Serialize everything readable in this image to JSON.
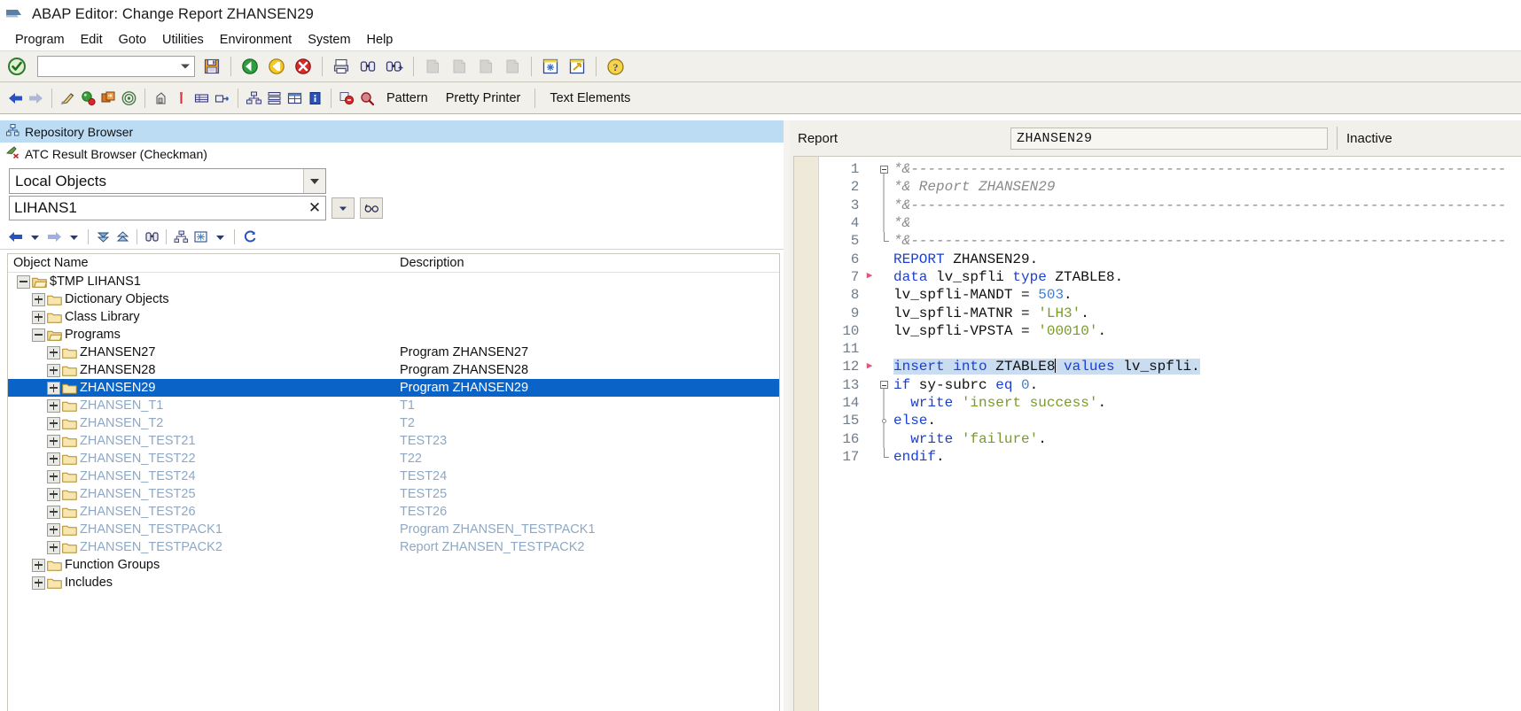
{
  "window": {
    "title": "ABAP Editor: Change Report ZHANSEN29",
    "logo_icon": "sap-ribbon-icon"
  },
  "menubar": {
    "items": [
      {
        "label": "Program"
      },
      {
        "label": "Edit"
      },
      {
        "label": "Goto"
      },
      {
        "label": "Utilities"
      },
      {
        "label": "Environment"
      },
      {
        "label": "System"
      },
      {
        "label": "Help"
      }
    ]
  },
  "toolbar_primary": {
    "enter_icon": "green-check-circle-icon",
    "command_field": {
      "value": "",
      "placeholder": ""
    },
    "command_dropdown_icon": "chevron-down-icon",
    "buttons": [
      {
        "name": "save-button",
        "icon": "save-disk-icon",
        "enabled": true
      },
      {
        "name": "back-button",
        "icon": "green-back-arrow-icon",
        "enabled": true
      },
      {
        "name": "exit-button",
        "icon": "yellow-exit-arrow-icon",
        "enabled": true
      },
      {
        "name": "cancel-button",
        "icon": "red-cancel-x-icon",
        "enabled": true
      },
      {
        "name": "print-button",
        "icon": "printer-icon",
        "enabled": true
      },
      {
        "name": "find-button",
        "icon": "binoculars-icon",
        "enabled": true
      },
      {
        "name": "find-next-button",
        "icon": "binoculars-plus-icon",
        "enabled": true
      },
      {
        "name": "first-page-button",
        "icon": "first-page-icon",
        "enabled": false
      },
      {
        "name": "previous-page-button",
        "icon": "previous-page-icon",
        "enabled": false
      },
      {
        "name": "next-page-button",
        "icon": "next-page-icon",
        "enabled": false
      },
      {
        "name": "last-page-button",
        "icon": "last-page-icon",
        "enabled": false
      },
      {
        "name": "create-session-button",
        "icon": "new-session-icon",
        "enabled": true
      },
      {
        "name": "create-shortcut-button",
        "icon": "shortcut-arrow-icon",
        "enabled": true
      },
      {
        "name": "help-button",
        "icon": "yellow-question-help-icon",
        "enabled": true
      }
    ]
  },
  "toolbar_secondary": {
    "buttons": [
      {
        "name": "back-nav-button",
        "icon": "blue-left-arrow-icon",
        "enabled": true
      },
      {
        "name": "forward-nav-button",
        "icon": "blue-right-arrow-icon",
        "enabled": false
      },
      {
        "name": "check-syntax-button",
        "icon": "syntax-check-pen-icon",
        "enabled": true
      },
      {
        "name": "activate-button",
        "icon": "activate-match-icon",
        "enabled": true
      },
      {
        "name": "display-change-button",
        "icon": "display-change-icon",
        "enabled": true
      },
      {
        "name": "where-used-button",
        "icon": "where-used-target-icon",
        "enabled": true
      },
      {
        "name": "debug-button",
        "icon": "debug-icon",
        "enabled": true
      },
      {
        "name": "breakpoint-button",
        "icon": "breakpoint-marker-icon",
        "enabled": true
      },
      {
        "name": "display-object-list-button",
        "icon": "object-list-icon",
        "enabled": true
      },
      {
        "name": "other-object-button",
        "icon": "other-object-icon",
        "enabled": true
      },
      {
        "name": "object-navigator-button",
        "icon": "navigator-tree-icon",
        "enabled": true
      },
      {
        "name": "stacked-list-button",
        "icon": "stacked-list-icon",
        "enabled": true
      },
      {
        "name": "table-display-button",
        "icon": "table-grid-icon",
        "enabled": true
      },
      {
        "name": "info-button",
        "icon": "blue-info-icon",
        "enabled": true
      },
      {
        "name": "replace-button",
        "icon": "replace-icon",
        "enabled": true
      },
      {
        "name": "search-object-button",
        "icon": "search-magnifier-icon",
        "enabled": true
      }
    ],
    "labels": [
      {
        "name": "pattern-button",
        "label": "Pattern"
      },
      {
        "name": "pretty-printer-button",
        "label": "Pretty Printer"
      },
      {
        "name": "text-elements-button",
        "label": "Text Elements"
      }
    ]
  },
  "left_panel": {
    "tabs": [
      {
        "label": "Repository Browser",
        "icon": "repository-tree-icon",
        "active": true
      },
      {
        "label": "ATC Result Browser (Checkman)",
        "icon": "atc-check-icon",
        "active": false
      }
    ],
    "object_type_select": {
      "value": "Local Objects",
      "options": [
        "Local Objects"
      ]
    },
    "search_field": {
      "value": "LIHANS1",
      "placeholder": "",
      "clear_icon": "close-x-icon",
      "dropdown_icon": "chevron-down-icon",
      "display_icon": "display-glasses-icon"
    },
    "tree_toolbar": [
      {
        "name": "tree-back-button",
        "icon": "left-arrow-icon"
      },
      {
        "name": "tree-back-history-button",
        "icon": "chevron-down-icon"
      },
      {
        "name": "tree-forward-button",
        "icon": "right-arrow-icon"
      },
      {
        "name": "tree-forward-history-button",
        "icon": "chevron-down-icon"
      },
      {
        "name": "expand-all-button",
        "icon": "expand-down-stack-icon"
      },
      {
        "name": "collapse-all-button",
        "icon": "collapse-up-stack-icon"
      },
      {
        "name": "find-in-tree-button",
        "icon": "binoculars-icon"
      },
      {
        "name": "tree-hierarchy-button",
        "icon": "hierarchy-icon"
      },
      {
        "name": "tree-layout-button",
        "icon": "layout-grid-icon"
      },
      {
        "name": "tree-layout-menu-button",
        "icon": "chevron-down-icon"
      },
      {
        "name": "refresh-tree-button",
        "icon": "refresh-icon"
      }
    ],
    "columns": [
      {
        "label": "Object Name"
      },
      {
        "label": "Description"
      }
    ],
    "tree": [
      {
        "name": "$TMP LIHANS1",
        "description": "",
        "depth": 0,
        "toggle": "minus",
        "folder": "open",
        "state": "normal"
      },
      {
        "name": "Dictionary Objects",
        "description": "",
        "depth": 1,
        "toggle": "plus",
        "folder": "closed",
        "state": "normal"
      },
      {
        "name": "Class Library",
        "description": "",
        "depth": 1,
        "toggle": "plus",
        "folder": "closed",
        "state": "normal"
      },
      {
        "name": "Programs",
        "description": "",
        "depth": 1,
        "toggle": "minus",
        "folder": "open",
        "state": "normal"
      },
      {
        "name": "ZHANSEN27",
        "description": "Program ZHANSEN27",
        "depth": 2,
        "toggle": "plus",
        "folder": "closed",
        "state": "normal"
      },
      {
        "name": "ZHANSEN28",
        "description": "Program ZHANSEN28",
        "depth": 2,
        "toggle": "plus",
        "folder": "closed",
        "state": "normal"
      },
      {
        "name": "ZHANSEN29",
        "description": "Program ZHANSEN29",
        "depth": 2,
        "toggle": "plus",
        "folder": "closed",
        "state": "selected"
      },
      {
        "name": "ZHANSEN_T1",
        "description": "T1",
        "depth": 2,
        "toggle": "plus",
        "folder": "closed",
        "state": "dim"
      },
      {
        "name": "ZHANSEN_T2",
        "description": "T2",
        "depth": 2,
        "toggle": "plus",
        "folder": "closed",
        "state": "dim"
      },
      {
        "name": "ZHANSEN_TEST21",
        "description": "TEST23",
        "depth": 2,
        "toggle": "plus",
        "folder": "closed",
        "state": "dim"
      },
      {
        "name": "ZHANSEN_TEST22",
        "description": "T22",
        "depth": 2,
        "toggle": "plus",
        "folder": "closed",
        "state": "dim"
      },
      {
        "name": "ZHANSEN_TEST24",
        "description": "TEST24",
        "depth": 2,
        "toggle": "plus",
        "folder": "closed",
        "state": "dim"
      },
      {
        "name": "ZHANSEN_TEST25",
        "description": "TEST25",
        "depth": 2,
        "toggle": "plus",
        "folder": "closed",
        "state": "dim"
      },
      {
        "name": "ZHANSEN_TEST26",
        "description": "TEST26",
        "depth": 2,
        "toggle": "plus",
        "folder": "closed",
        "state": "dim"
      },
      {
        "name": "ZHANSEN_TESTPACK1",
        "description": "Program ZHANSEN_TESTPACK1",
        "depth": 2,
        "toggle": "plus",
        "folder": "closed",
        "state": "dim"
      },
      {
        "name": "ZHANSEN_TESTPACK2",
        "description": "Report ZHANSEN_TESTPACK2",
        "depth": 2,
        "toggle": "plus",
        "folder": "closed",
        "state": "dim"
      },
      {
        "name": "Function Groups",
        "description": "",
        "depth": 1,
        "toggle": "plus",
        "folder": "closed",
        "state": "normal"
      },
      {
        "name": "Includes",
        "description": "",
        "depth": 1,
        "toggle": "plus",
        "folder": "closed",
        "state": "normal"
      }
    ]
  },
  "right_panel": {
    "report_label": "Report",
    "report_name": "ZHANSEN29",
    "status": "Inactive",
    "code": [
      {
        "num": "1",
        "breakpoint": false,
        "fold": "start",
        "tokens": [
          {
            "t": "*&----------------------------------------------------------------------",
            "c": "cmt"
          }
        ]
      },
      {
        "num": "2",
        "breakpoint": false,
        "fold": "line",
        "tokens": [
          {
            "t": "*& Report ZHANSEN29",
            "c": "cmt"
          }
        ]
      },
      {
        "num": "3",
        "breakpoint": false,
        "fold": "line",
        "tokens": [
          {
            "t": "*&----------------------------------------------------------------------",
            "c": "cmt"
          }
        ]
      },
      {
        "num": "4",
        "breakpoint": false,
        "fold": "line",
        "tokens": [
          {
            "t": "*&",
            "c": "cmt"
          }
        ]
      },
      {
        "num": "5",
        "breakpoint": false,
        "fold": "end",
        "tokens": [
          {
            "t": "*&----------------------------------------------------------------------",
            "c": "cmt"
          }
        ]
      },
      {
        "num": "6",
        "breakpoint": false,
        "fold": "none",
        "tokens": [
          {
            "t": "REPORT",
            "c": "kw"
          },
          {
            "t": " ZHANSEN29.",
            "c": "plain"
          }
        ]
      },
      {
        "num": "7",
        "breakpoint": true,
        "fold": "none",
        "tokens": [
          {
            "t": "data",
            "c": "kw"
          },
          {
            "t": " lv_spfli ",
            "c": "plain"
          },
          {
            "t": "type",
            "c": "kw"
          },
          {
            "t": " ZTABLE8.",
            "c": "plain"
          }
        ]
      },
      {
        "num": "8",
        "breakpoint": false,
        "fold": "none",
        "tokens": [
          {
            "t": "lv_spfli-MANDT = ",
            "c": "plain"
          },
          {
            "t": "503",
            "c": "num"
          },
          {
            "t": ".",
            "c": "plain"
          }
        ]
      },
      {
        "num": "9",
        "breakpoint": false,
        "fold": "none",
        "tokens": [
          {
            "t": "lv_spfli-MATNR = ",
            "c": "plain"
          },
          {
            "t": "'LH3'",
            "c": "str"
          },
          {
            "t": ".",
            "c": "plain"
          }
        ]
      },
      {
        "num": "10",
        "breakpoint": false,
        "fold": "none",
        "tokens": [
          {
            "t": "lv_spfli-VPSTA = ",
            "c": "plain"
          },
          {
            "t": "'00010'",
            "c": "str"
          },
          {
            "t": ".",
            "c": "plain"
          }
        ]
      },
      {
        "num": "11",
        "breakpoint": false,
        "fold": "none",
        "tokens": []
      },
      {
        "num": "12",
        "breakpoint": true,
        "fold": "none",
        "selected": true,
        "tokens": [
          {
            "t": "insert into",
            "c": "kw"
          },
          {
            "t": " ZTABLE8",
            "c": "plain"
          },
          {
            "t": "|CARET|",
            "c": "caret"
          },
          {
            "t": " ",
            "c": "plain"
          },
          {
            "t": "values",
            "c": "kw"
          },
          {
            "t": " lv_spfli.",
            "c": "plain"
          }
        ]
      },
      {
        "num": "13",
        "breakpoint": false,
        "fold": "start",
        "tokens": [
          {
            "t": "if",
            "c": "kw"
          },
          {
            "t": " sy-subrc ",
            "c": "plain"
          },
          {
            "t": "eq",
            "c": "kw"
          },
          {
            "t": " ",
            "c": "plain"
          },
          {
            "t": "0",
            "c": "num"
          },
          {
            "t": ".",
            "c": "plain"
          }
        ]
      },
      {
        "num": "14",
        "breakpoint": false,
        "fold": "line",
        "tokens": [
          {
            "t": "  ",
            "c": "plain"
          },
          {
            "t": "write",
            "c": "kw"
          },
          {
            "t": " ",
            "c": "plain"
          },
          {
            "t": "'insert success'",
            "c": "str"
          },
          {
            "t": ".",
            "c": "plain"
          }
        ]
      },
      {
        "num": "15",
        "breakpoint": false,
        "fold": "dot",
        "tokens": [
          {
            "t": "else",
            "c": "kw"
          },
          {
            "t": ".",
            "c": "plain"
          }
        ]
      },
      {
        "num": "16",
        "breakpoint": false,
        "fold": "line",
        "tokens": [
          {
            "t": "  ",
            "c": "plain"
          },
          {
            "t": "write",
            "c": "kw"
          },
          {
            "t": " ",
            "c": "plain"
          },
          {
            "t": "'failure'",
            "c": "str"
          },
          {
            "t": ".",
            "c": "plain"
          }
        ]
      },
      {
        "num": "17",
        "breakpoint": false,
        "fold": "end",
        "tokens": [
          {
            "t": "endif",
            "c": "kw"
          },
          {
            "t": ".",
            "c": "plain"
          }
        ]
      }
    ]
  },
  "colors": {
    "selection_blue": "#0a64c8",
    "tab_active_blue": "#bcdcf4",
    "dim_text": "#8ea8c4",
    "keyword_blue": "#1a3fd4",
    "string_green": "#7a9a2e",
    "comment_gray": "#8a8a8a",
    "number_blue": "#3f7fd0",
    "toolbar_bg": "#f1f0ea",
    "gutter_bg": "#efe9d9",
    "breakpoint_pink": "#e0557a"
  }
}
